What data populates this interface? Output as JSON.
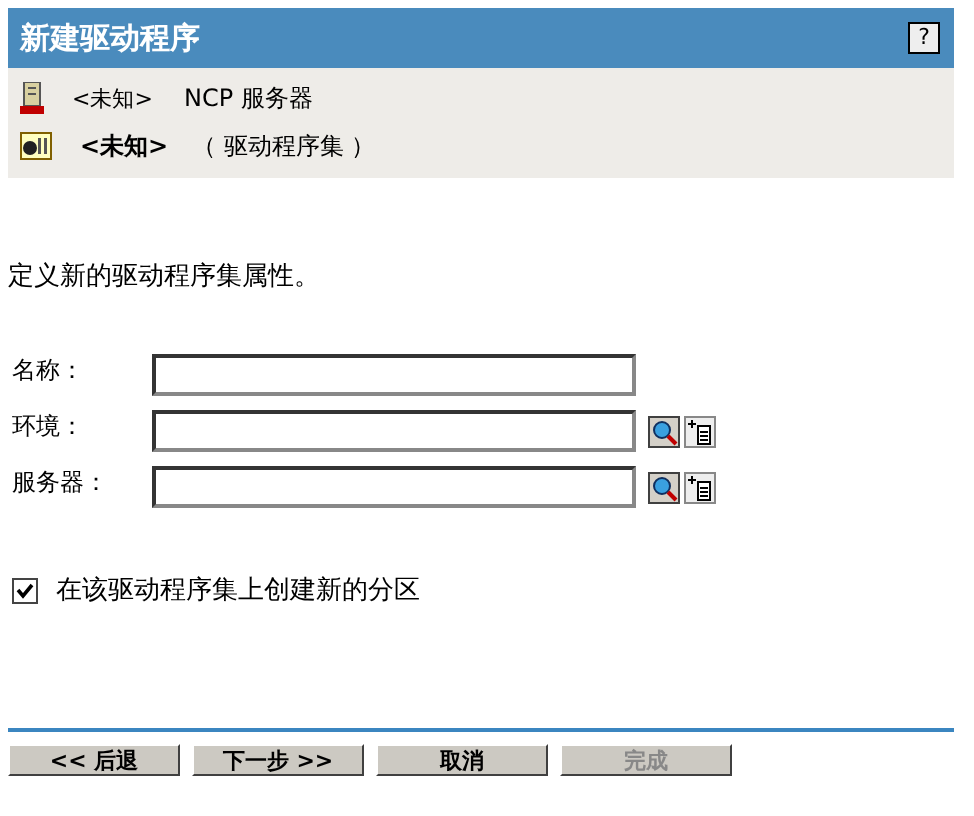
{
  "window": {
    "title": "新建驱动程序",
    "help": "?"
  },
  "objects": [
    {
      "kind": "server",
      "name": "<未知>",
      "type": "NCP 服务器",
      "bold": false
    },
    {
      "kind": "driverset",
      "name": "<未知>",
      "type": "（ 驱动程序集 ）",
      "bold": true
    }
  ],
  "description": "定义新的驱动程序集属性。",
  "fields": [
    {
      "label": "名称：",
      "browse": false
    },
    {
      "label": "环境：",
      "browse": true
    },
    {
      "label": "服务器：",
      "browse": true
    }
  ],
  "option": {
    "label": "在该驱动程序集上创建新的分区",
    "checked": true
  },
  "buttons": [
    {
      "label": "<< 后退",
      "disabled": false
    },
    {
      "label": "下一步 >>",
      "disabled": false
    },
    {
      "label": "取消",
      "disabled": false
    },
    {
      "label": "完成",
      "disabled": true
    }
  ]
}
